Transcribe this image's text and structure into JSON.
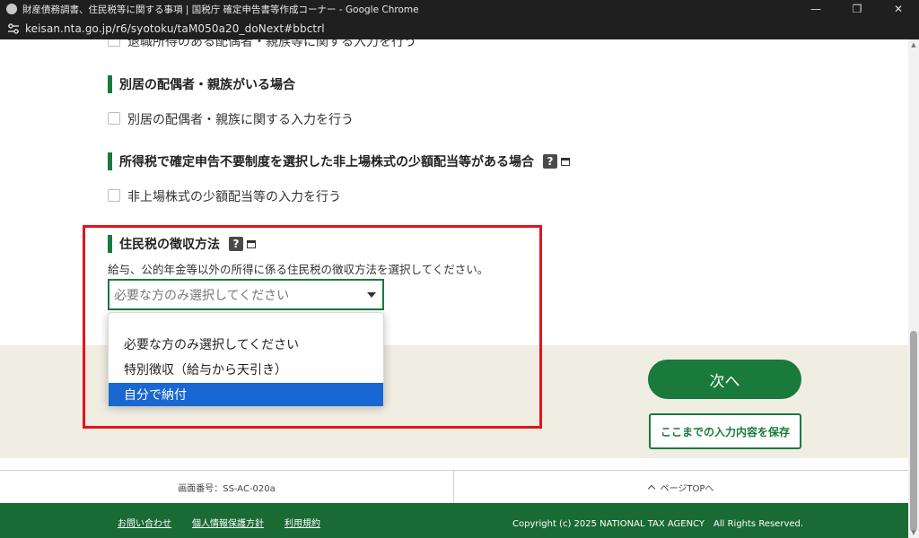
{
  "browser": {
    "window_title": "財産債務調書、住民税等に関する事項 | 国税庁 確定申告書等作成コーナー - Google Chrome",
    "url": "keisan.nta.go.jp/r6/syotoku/taM050a20_doNext#bbctrl",
    "controls": {
      "minimize": "—",
      "restore": "❐",
      "close": "✕"
    }
  },
  "partial_top_checkbox": {
    "label": "退職所得のある配偶者・親族等に関する入力を行う"
  },
  "sections": [
    {
      "heading": "別居の配偶者・親族がいる場合",
      "checkbox_label": "別居の配偶者・親族に関する入力を行う",
      "has_help": false
    },
    {
      "heading": "所得税で確定申告不要制度を選択した非上場株式の少額配当等がある場合",
      "checkbox_label": "非上場株式の少額配当等の入力を行う",
      "has_help": true,
      "help_label": "?"
    }
  ],
  "residence_tax": {
    "heading": "住民税の徴収方法",
    "help_label": "?",
    "description": "給与、公的年金等以外の所得に係る住民税の徴収方法を選択してください。",
    "select": {
      "current_value": "必要な方のみ選択してください",
      "options": [
        "必要な方のみ選択してください",
        "特別徴収（給与から天引き）",
        "自分で納付"
      ],
      "highlighted_option": "自分で納付"
    }
  },
  "actions": {
    "next_label": "次へ",
    "save_label": "ここまでの入力内容を保存"
  },
  "info": {
    "screen_id": "画面番号：SS-AC-020a",
    "page_top": "ページTOPへ"
  },
  "footer": {
    "links": [
      "お問い合わせ",
      "個人情報保護方針",
      "利用規約"
    ],
    "copyright": "Copyright (c) 2025 NATIONAL TAX AGENCY　All Rights Reserved."
  },
  "colors": {
    "accent_green": "#1a7a3c",
    "footer_green": "#1a6a34",
    "highlight_red": "#e0141e",
    "option_selected_blue": "#1967d2",
    "band_beige": "#f0ede3"
  }
}
